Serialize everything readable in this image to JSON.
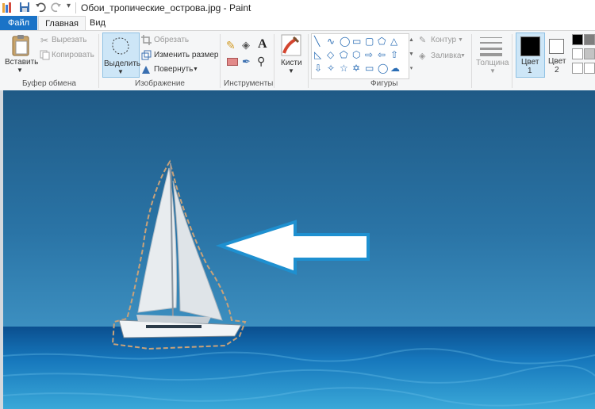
{
  "window": {
    "title": "Обои_тропические_острова.jpg - Paint"
  },
  "tabs": {
    "file": "Файл",
    "home": "Главная",
    "view": "Вид"
  },
  "clipboard": {
    "paste": "Вставить",
    "cut": "Вырезать",
    "copy": "Копировать",
    "group": "Буфер обмена"
  },
  "image": {
    "select": "Выделить",
    "crop": "Обрезать",
    "resize": "Изменить размер",
    "rotate": "Повернуть",
    "group": "Изображение"
  },
  "tools": {
    "group": "Инструменты",
    "brushes": "Кисти"
  },
  "shapes": {
    "group": "Фигуры",
    "outline": "Контур",
    "fill": "Заливка"
  },
  "size": {
    "label": "Толщина"
  },
  "colors": {
    "color1": "Цвет",
    "color1_num": "1",
    "color2": "Цвет",
    "color2_num": "2",
    "palette": [
      "#000000",
      "#7f7f7f",
      "#ffffff",
      "#c3c3c3"
    ]
  }
}
